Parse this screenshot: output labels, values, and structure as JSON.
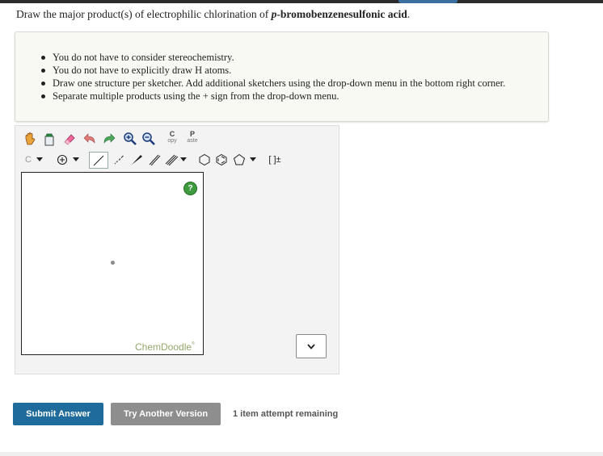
{
  "question": {
    "prefix": "Draw the major product(s) of electrophilic chlorination of ",
    "compound_italic": "p",
    "compound_rest": "-bromobenzenesulfonic acid",
    "suffix": "."
  },
  "instructions": [
    "You do not have to consider stereochemistry.",
    "You do not have to explicitly draw H atoms.",
    "Draw one structure per sketcher. Add additional sketchers using the drop-down menu in the bottom right corner.",
    "Separate multiple products using the + sign from the drop-down menu."
  ],
  "toolbar": {
    "copy_letter": "C",
    "copy_sub": "opy",
    "paste_letter": "P",
    "paste_sub": "aste",
    "atom_label": "C",
    "bracket_label": "[ ]±"
  },
  "canvas": {
    "help_label": "?",
    "brand": "ChemDoodle",
    "brand_mark": "®"
  },
  "actions": {
    "submit": "Submit Answer",
    "try_another": "Try Another Version",
    "attempts": "1 item attempt remaining"
  },
  "colors": {
    "submit_bg": "#1f6b9c",
    "try_bg": "#8e8e8e",
    "brand_color": "#93a86a"
  }
}
